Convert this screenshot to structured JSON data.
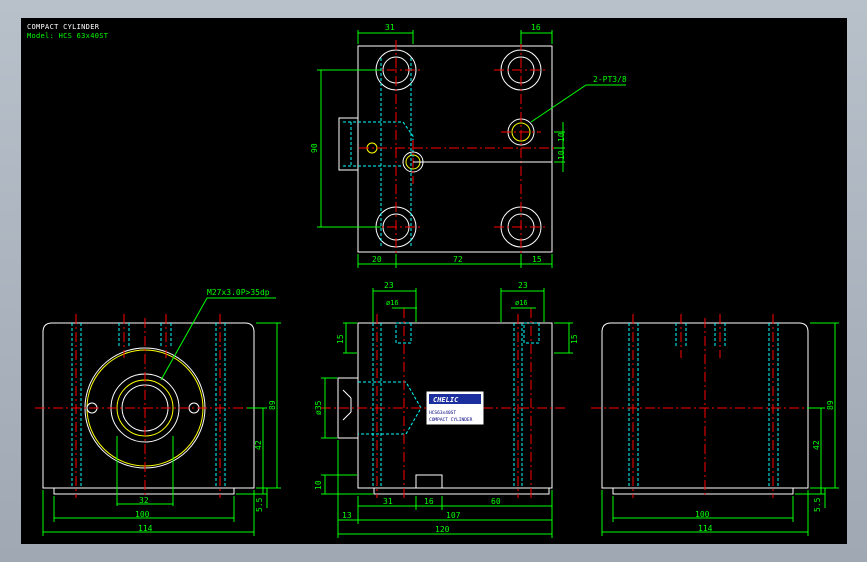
{
  "header": {
    "title": "COMPACT CYLINDER",
    "model": "Model: HCS 63x40ST"
  },
  "colors": {
    "background": "#000000",
    "outline": "#ffffff",
    "dimension": "#00ff00",
    "hidden": "#00ffff",
    "center": "#ff0000",
    "thread": "#ffff00"
  },
  "top_view": {
    "dims": {
      "top_left": "31",
      "top_right": "16",
      "left_height": "90",
      "right_upper": "10",
      "right_lower": "10",
      "bottom_left": "20",
      "bottom_middle": "72",
      "bottom_right": "15"
    },
    "port_label": "2-PT3/8"
  },
  "front_view": {
    "thread_label": "M27x3.0P>35dp",
    "dims": {
      "height": "89",
      "inner_height": "42",
      "base": "5.5",
      "bore": "32",
      "inner_width": "100",
      "outer_width": "114"
    }
  },
  "side_view": {
    "dims": {
      "left_top": "23",
      "right_top": "23",
      "left_hole": "ø16",
      "right_hole": "ø16",
      "top_thickness": "15",
      "rod_diameter": "ø35",
      "bottom_thickness": "10",
      "seg1": "31",
      "seg2": "16",
      "seg3": "60",
      "rod_len": "13",
      "body_len": "107",
      "total_len": "120"
    },
    "label_brand": "CHELIC",
    "label_code": "HCS63x40ST",
    "label_text": "COMPACT CYLINDER"
  },
  "right_view": {
    "dims": {
      "height": "89",
      "inner_height": "42",
      "base": "5.5",
      "inner_width": "100",
      "outer_width": "114"
    }
  }
}
